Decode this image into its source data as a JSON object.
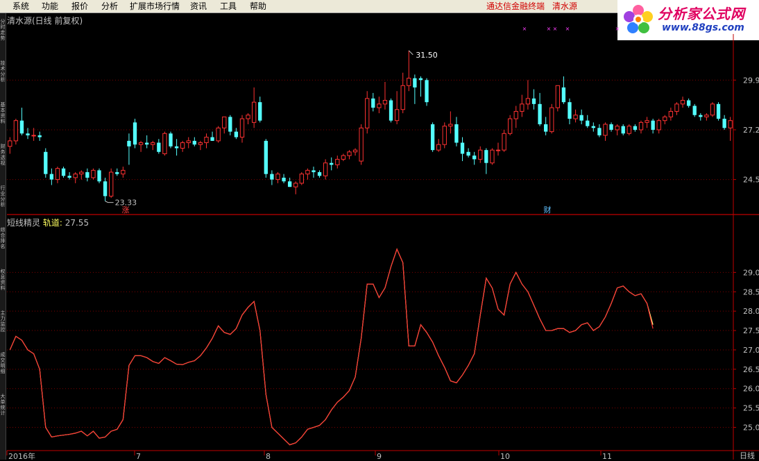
{
  "menu": {
    "items": [
      "系统",
      "功能",
      "报价",
      "分析",
      "扩展市场行情",
      "资讯",
      "工具",
      "帮助"
    ],
    "right_links": [
      "通达信金融终端",
      "清水源"
    ]
  },
  "logo": {
    "title": "分析家公式网",
    "url": "www.88gs.com"
  },
  "sidebar": {
    "tabs": [
      "分时走势",
      "技术分析",
      "基本资料",
      "财务透视",
      "行业分析",
      "综合排名",
      "权息资料",
      "主力监控",
      "成交明细",
      "大单统计"
    ]
  },
  "main_chart": {
    "title": "清水源(日线 前复权)",
    "high_label": "31.50",
    "low_label": "23.33",
    "event_markers": [
      "涨",
      "财"
    ],
    "y_ticks": [
      "29.9",
      "27.2",
      "24.5"
    ]
  },
  "indicator": {
    "name": "短线精灵",
    "series_label": "轨道:",
    "value": "27.55",
    "y_ticks": [
      "29.0",
      "28.5",
      "28.0",
      "27.5",
      "27.0",
      "26.5",
      "26.0",
      "25.5",
      "25.0"
    ]
  },
  "x_axis": {
    "labels": [
      "2016年",
      "7",
      "8",
      "9",
      "10",
      "11"
    ]
  },
  "timeframe_label": "日线",
  "colors": {
    "up": "#ff3232",
    "down": "#54ffff",
    "grid": "#800000",
    "axis": "#c00000",
    "guide": "#ffff80",
    "marker": "#ff40ff"
  },
  "chart_data": {
    "type": "candlestick",
    "candles": [
      [
        26.3,
        26.8,
        25.9,
        26.6
      ],
      [
        26.6,
        27.8,
        26.4,
        27.7
      ],
      [
        27.7,
        28.4,
        26.9,
        27.0
      ],
      [
        27.0,
        27.3,
        26.7,
        26.9
      ],
      [
        26.9,
        27.3,
        26.6,
        26.9
      ],
      [
        26.9,
        27.1,
        26.6,
        26.8
      ],
      [
        26.0,
        26.2,
        24.6,
        24.8
      ],
      [
        24.8,
        25.1,
        24.2,
        24.5
      ],
      [
        24.5,
        25.2,
        24.3,
        25.1
      ],
      [
        25.1,
        25.2,
        24.6,
        24.7
      ],
      [
        24.7,
        24.9,
        24.5,
        24.6
      ],
      [
        24.6,
        24.9,
        24.3,
        24.8
      ],
      [
        24.8,
        25.0,
        24.5,
        24.9
      ],
      [
        24.9,
        25.1,
        24.4,
        24.6
      ],
      [
        24.6,
        25.1,
        24.5,
        25.0
      ],
      [
        25.0,
        25.1,
        24.3,
        24.4
      ],
      [
        24.4,
        24.6,
        23.33,
        23.6
      ],
      [
        23.6,
        25.1,
        23.5,
        24.9
      ],
      [
        24.9,
        25.1,
        24.7,
        24.8
      ],
      [
        24.8,
        25.2,
        24.6,
        25.0
      ],
      [
        26.6,
        27.0,
        25.3,
        26.3
      ],
      [
        27.6,
        27.8,
        26.2,
        26.4
      ],
      [
        26.4,
        26.6,
        26.0,
        26.5
      ],
      [
        26.5,
        26.9,
        26.2,
        26.4
      ],
      [
        26.4,
        26.6,
        26.1,
        26.5
      ],
      [
        26.5,
        26.7,
        25.9,
        26.0
      ],
      [
        25.9,
        27.1,
        25.8,
        27.0
      ],
      [
        27.0,
        27.1,
        26.2,
        26.3
      ],
      [
        26.3,
        26.7,
        25.8,
        26.2
      ],
      [
        26.2,
        26.6,
        26.0,
        26.5
      ],
      [
        26.5,
        26.8,
        26.2,
        26.6
      ],
      [
        26.6,
        26.8,
        26.3,
        26.4
      ],
      [
        26.4,
        26.6,
        26.1,
        26.5
      ],
      [
        26.5,
        27.0,
        26.2,
        26.8
      ],
      [
        26.8,
        27.1,
        26.6,
        26.6
      ],
      [
        26.6,
        27.4,
        26.5,
        27.3
      ],
      [
        27.3,
        27.9,
        27.0,
        27.9
      ],
      [
        27.9,
        28.0,
        26.9,
        27.1
      ],
      [
        27.1,
        27.3,
        26.7,
        26.8
      ],
      [
        26.8,
        28.0,
        26.5,
        27.8
      ],
      [
        27.8,
        28.1,
        27.5,
        28.0
      ],
      [
        27.6,
        29.5,
        27.3,
        28.7
      ],
      [
        28.7,
        29.0,
        27.6,
        27.7
      ],
      [
        26.6,
        26.7,
        24.6,
        24.8
      ],
      [
        24.8,
        25.0,
        24.2,
        24.5
      ],
      [
        24.5,
        24.9,
        24.3,
        24.8
      ],
      [
        24.6,
        24.8,
        24.3,
        24.4
      ],
      [
        24.4,
        24.6,
        24.1,
        24.1
      ],
      [
        24.1,
        24.4,
        23.7,
        24.3
      ],
      [
        24.3,
        24.9,
        24.2,
        24.8
      ],
      [
        24.8,
        25.1,
        24.5,
        25.0
      ],
      [
        25.0,
        25.2,
        24.6,
        24.9
      ],
      [
        24.9,
        25.0,
        24.6,
        24.7
      ],
      [
        24.7,
        25.6,
        24.5,
        25.4
      ],
      [
        25.4,
        25.7,
        25.0,
        25.3
      ],
      [
        25.3,
        25.8,
        25.1,
        25.6
      ],
      [
        25.6,
        25.9,
        25.5,
        25.8
      ],
      [
        25.8,
        26.1,
        25.6,
        26.0
      ],
      [
        26.0,
        26.2,
        25.8,
        26.1
      ],
      [
        25.5,
        27.5,
        25.3,
        27.3
      ],
      [
        27.3,
        29.3,
        27.0,
        28.9
      ],
      [
        28.9,
        29.2,
        28.2,
        28.4
      ],
      [
        28.4,
        29.0,
        28.1,
        28.6
      ],
      [
        28.6,
        29.8,
        28.3,
        28.8
      ],
      [
        28.8,
        28.9,
        27.6,
        27.7
      ],
      [
        27.7,
        29.3,
        27.5,
        28.3
      ],
      [
        28.3,
        30.3,
        28.1,
        29.6
      ],
      [
        29.6,
        31.5,
        29.3,
        30.0
      ],
      [
        30.0,
        30.2,
        28.6,
        29.5
      ],
      [
        30.0,
        30.1,
        29.0,
        29.9
      ],
      [
        29.9,
        30.0,
        28.5,
        28.7
      ],
      [
        27.5,
        27.6,
        26.0,
        26.1
      ],
      [
        26.1,
        26.7,
        26.0,
        26.4
      ],
      [
        26.4,
        27.6,
        26.2,
        27.4
      ],
      [
        27.4,
        28.2,
        27.0,
        27.5
      ],
      [
        27.5,
        27.9,
        26.3,
        26.5
      ],
      [
        26.5,
        26.8,
        25.5,
        25.9
      ],
      [
        26.0,
        26.2,
        25.7,
        25.8
      ],
      [
        25.8,
        26.0,
        25.3,
        25.6
      ],
      [
        25.6,
        26.3,
        25.4,
        26.1
      ],
      [
        26.1,
        26.2,
        24.8,
        25.4
      ],
      [
        25.4,
        26.2,
        25.3,
        26.1
      ],
      [
        26.1,
        26.5,
        25.8,
        26.1
      ],
      [
        26.1,
        27.2,
        26.0,
        27.0
      ],
      [
        27.0,
        28.0,
        26.9,
        27.8
      ],
      [
        27.8,
        28.5,
        27.3,
        28.2
      ],
      [
        28.2,
        29.1,
        27.9,
        28.6
      ],
      [
        28.6,
        29.9,
        28.3,
        28.9
      ],
      [
        28.9,
        29.4,
        28.3,
        28.6
      ],
      [
        28.6,
        29.2,
        27.4,
        27.5
      ],
      [
        27.5,
        27.9,
        26.9,
        27.1
      ],
      [
        27.1,
        28.6,
        27.0,
        28.4
      ],
      [
        28.4,
        29.5,
        28.2,
        29.6
      ],
      [
        29.5,
        30.1,
        28.6,
        28.7
      ],
      [
        28.7,
        28.9,
        27.5,
        27.8
      ],
      [
        27.8,
        28.3,
        27.6,
        28.0
      ],
      [
        28.0,
        28.3,
        27.5,
        27.7
      ],
      [
        27.7,
        28.0,
        27.3,
        27.4
      ],
      [
        27.4,
        27.6,
        27.1,
        27.3
      ],
      [
        27.3,
        27.5,
        26.8,
        26.9
      ],
      [
        26.9,
        27.6,
        26.6,
        27.5
      ],
      [
        27.5,
        27.6,
        27.1,
        27.2
      ],
      [
        27.2,
        27.5,
        26.9,
        27.4
      ],
      [
        27.4,
        27.5,
        26.9,
        27.0
      ],
      [
        27.0,
        27.5,
        26.9,
        27.4
      ],
      [
        27.4,
        27.5,
        27.1,
        27.2
      ],
      [
        27.2,
        27.7,
        27.0,
        27.6
      ],
      [
        27.6,
        27.9,
        27.3,
        27.7
      ],
      [
        27.7,
        27.8,
        27.0,
        27.2
      ],
      [
        27.2,
        27.8,
        27.0,
        27.7
      ],
      [
        27.7,
        28.0,
        27.5,
        27.9
      ],
      [
        27.9,
        28.4,
        27.7,
        28.2
      ],
      [
        28.2,
        28.7,
        28.0,
        28.6
      ],
      [
        28.6,
        29.0,
        28.4,
        28.8
      ],
      [
        28.8,
        28.9,
        28.4,
        28.5
      ],
      [
        28.5,
        28.6,
        27.9,
        28.0
      ],
      [
        28.0,
        28.1,
        27.7,
        27.9
      ],
      [
        27.9,
        28.1,
        27.7,
        28.0
      ],
      [
        28.0,
        28.7,
        27.9,
        28.6
      ],
      [
        28.6,
        28.7,
        27.7,
        27.8
      ],
      [
        27.8,
        28.0,
        27.2,
        27.3
      ],
      [
        27.3,
        27.9,
        26.6,
        27.7
      ]
    ],
    "guide_line": [
      27.0,
      27.35,
      27.25,
      27.0,
      26.9,
      26.5,
      25.0,
      24.75,
      24.78,
      24.8,
      24.82,
      24.85,
      24.9,
      24.78,
      24.9,
      24.72,
      24.75,
      24.9,
      24.95,
      25.2,
      26.6,
      26.85,
      26.85,
      26.8,
      26.7,
      26.65,
      26.8,
      26.72,
      26.63,
      26.62,
      26.68,
      26.72,
      26.85,
      27.05,
      27.3,
      27.62,
      27.45,
      27.4,
      27.55,
      27.9,
      28.1,
      28.25,
      27.5,
      25.85,
      25.0,
      24.85,
      24.7,
      24.55,
      24.6,
      24.75,
      24.95,
      25.0,
      25.05,
      25.2,
      25.45,
      25.65,
      25.78,
      25.95,
      26.3,
      27.3,
      28.7,
      28.7,
      28.35,
      28.6,
      29.15,
      29.6,
      29.25,
      27.1,
      27.1,
      27.65,
      27.45,
      27.2,
      26.85,
      26.55,
      26.2,
      26.15,
      26.35,
      26.6,
      26.9,
      27.9,
      28.85,
      28.6,
      28.05,
      27.9,
      28.7,
      29.0,
      28.7,
      28.5,
      28.15,
      27.8,
      27.5,
      27.5,
      27.55,
      27.55,
      27.45,
      27.5,
      27.65,
      27.7,
      27.5,
      27.6,
      27.85,
      28.2,
      28.6,
      28.65,
      28.5,
      28.4,
      28.45,
      28.2,
      27.65
    ],
    "track_line": [
      27.0,
      27.35,
      27.25,
      27.0,
      26.9,
      26.5,
      25.0,
      24.75,
      24.78,
      24.8,
      24.82,
      24.85,
      24.9,
      24.78,
      24.9,
      24.72,
      24.75,
      24.9,
      24.95,
      25.2,
      26.6,
      26.85,
      26.85,
      26.8,
      26.7,
      26.65,
      26.8,
      26.72,
      26.63,
      26.62,
      26.68,
      26.72,
      26.85,
      27.05,
      27.3,
      27.62,
      27.45,
      27.4,
      27.55,
      27.9,
      28.1,
      28.25,
      27.5,
      25.85,
      25.0,
      24.85,
      24.7,
      24.55,
      24.6,
      24.75,
      24.95,
      25.0,
      25.05,
      25.2,
      25.45,
      25.65,
      25.78,
      25.95,
      26.3,
      27.3,
      28.7,
      28.7,
      28.35,
      28.6,
      29.15,
      29.6,
      29.25,
      27.1,
      27.1,
      27.65,
      27.45,
      27.2,
      26.85,
      26.55,
      26.2,
      26.15,
      26.35,
      26.6,
      26.9,
      27.9,
      28.85,
      28.6,
      28.05,
      27.9,
      28.7,
      29.0,
      28.7,
      28.5,
      28.15,
      27.8,
      27.5,
      27.5,
      27.55,
      27.55,
      27.45,
      27.5,
      27.65,
      27.7,
      27.5,
      27.6,
      27.85,
      28.2,
      28.6,
      28.65,
      28.5,
      28.4,
      28.45,
      28.2,
      27.55
    ],
    "main_ylim": [
      22.6,
      32.4
    ],
    "indicator_ylim": [
      24.4,
      30.1
    ]
  }
}
